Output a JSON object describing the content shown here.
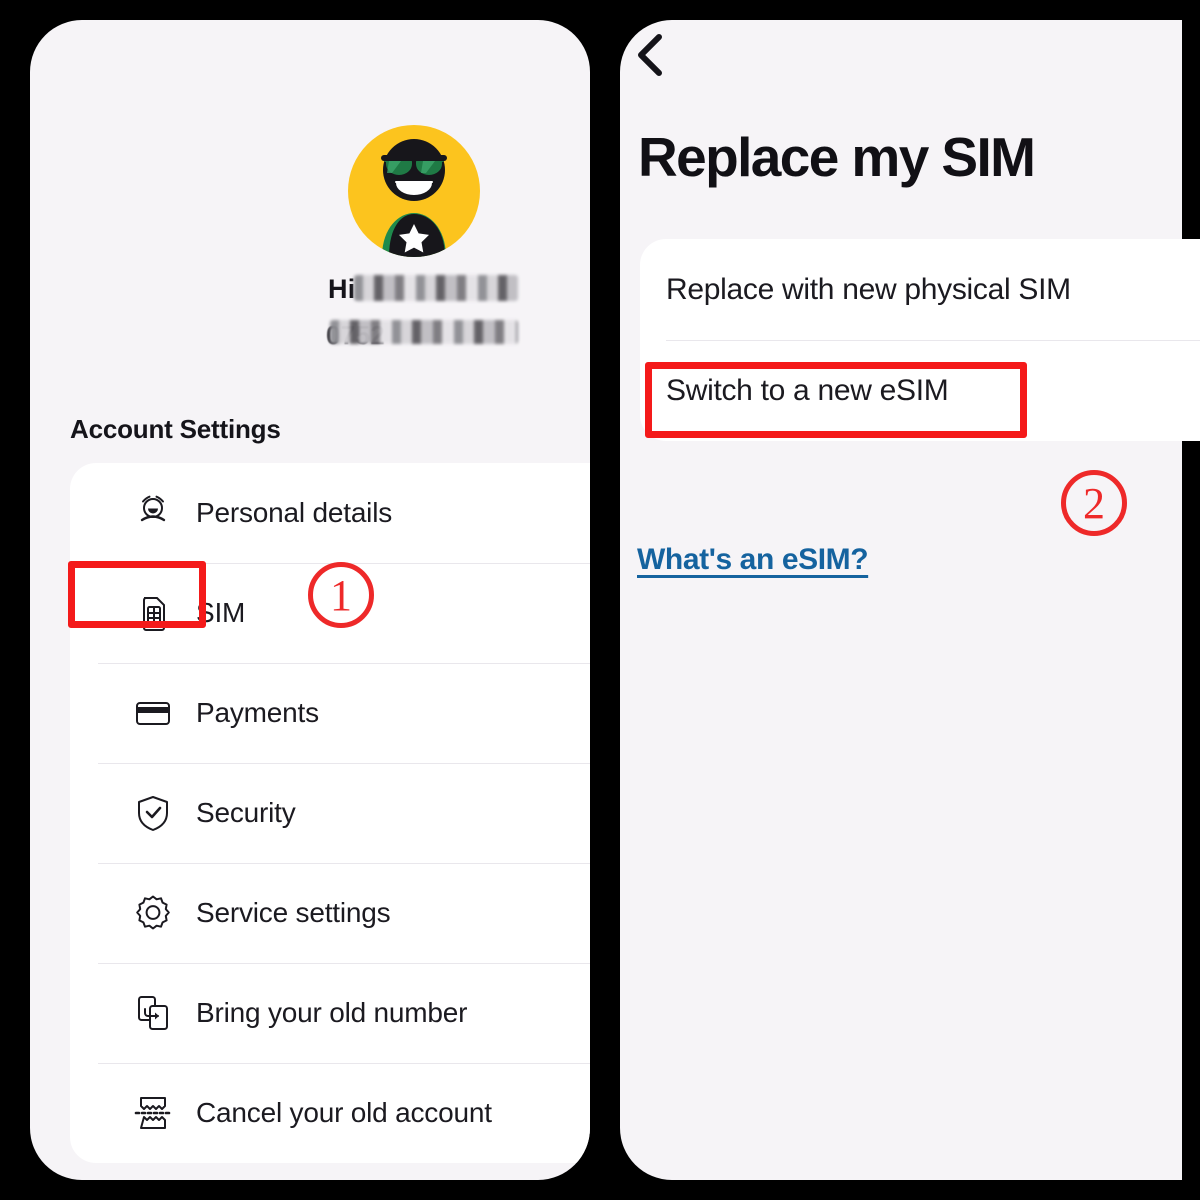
{
  "theme": {
    "outer_background": "#000000",
    "screen_background": "#F6F4F7",
    "card_background": "#FFFFFF",
    "text_primary": "#1B1A20",
    "link_blue": "#15639F",
    "annotation_red": "#F41A1A",
    "avatar_yellow": "#FCC41E",
    "avatar_green": "#1F8A4C"
  },
  "left_screen": {
    "avatar": {
      "icon": "avatar-sunglasses-star",
      "background_color": "#FCC41E"
    },
    "greeting_prefix": "Hi",
    "redacted_name": "",
    "phone_number_prefix": "0752",
    "redacted_phone": "",
    "section_title": "Account Settings",
    "menu_items": [
      {
        "label": "Personal details",
        "icon": "person-details-icon"
      },
      {
        "label": "SIM",
        "icon": "sim-card-icon"
      },
      {
        "label": "Payments",
        "icon": "credit-card-icon"
      },
      {
        "label": "Security",
        "icon": "shield-check-icon"
      },
      {
        "label": "Service settings",
        "icon": "gear-icon"
      },
      {
        "label": "Bring your old number",
        "icon": "phone-transfer-icon"
      },
      {
        "label": "Cancel your old account",
        "icon": "torn-paper-icon"
      }
    ]
  },
  "right_screen": {
    "back_icon": "chevron-left-icon",
    "title": "Replace my SIM",
    "options": [
      {
        "label": "Replace with new physical SIM"
      },
      {
        "label": "Switch to a new eSIM"
      }
    ],
    "link": "What's an eSIM?"
  },
  "annotations": {
    "markers": [
      {
        "label": "1",
        "target": "SIM"
      },
      {
        "label": "2",
        "target": "Switch to a new eSIM"
      }
    ],
    "highlight_boxes": [
      {
        "target": "SIM"
      },
      {
        "target": "Switch to a new eSIM"
      }
    ]
  }
}
